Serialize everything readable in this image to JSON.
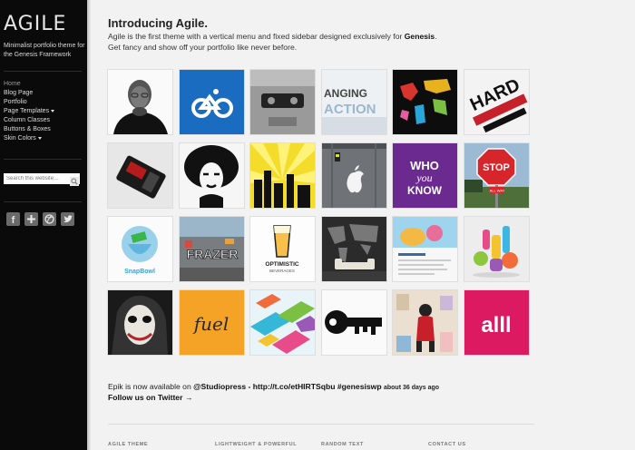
{
  "sidebar": {
    "logo": "AGILE",
    "tagline": "Minimalist portfolio theme for the Genesis Framework",
    "menu": [
      "Home",
      "Blog Page",
      "Portfolio",
      "Page Templates",
      "Column Classes",
      "Buttons & Boxes",
      "Skin Colors"
    ],
    "search_placeholder": "Search this website…",
    "social_icons": [
      "facebook-icon",
      "google-plus-icon",
      "dribbble-icon",
      "twitter-icon"
    ]
  },
  "intro": {
    "title": "Introducing Agile.",
    "line1_pre": "Agile is the first theme with a vertical menu and fixed sidebar designed exclusively for ",
    "line1_bold": "Genesis",
    "line1_post": ".",
    "line2": "Get fancy and show off your portfolio like never before."
  },
  "portfolio": {
    "thumbs": [
      "thumb-portrait-man",
      "thumb-bike-logo",
      "thumb-cassette",
      "thumb-changing-action",
      "thumb-word-map",
      "thumb-hard-typography",
      "thumb-gadget",
      "thumb-afro-portrait",
      "thumb-city-rays",
      "thumb-apple-store",
      "thumb-who-you-know",
      "thumb-stop-sign",
      "thumb-snapbowl",
      "thumb-graffiti",
      "thumb-optimistic-beverages",
      "thumb-dot-world-map",
      "thumb-website-shot",
      "thumb-colorful-figures",
      "thumb-joker",
      "thumb-fuel",
      "thumb-isometric",
      "thumb-key",
      "thumb-collage",
      "thumb-alll"
    ],
    "texts": {
      "action_top": "ANGING",
      "action_bottom": "ACTION",
      "hard": "HARD",
      "who1": "WHO",
      "who2": "you",
      "who3": "KNOW",
      "stop": "STOP",
      "stop_sub": "ALL WAY",
      "snapbowl": "SnapBowl",
      "optimistic1": "OPTIMISTIC",
      "optimistic2": "BEVERAGES",
      "fuel": "fuel",
      "alll": "alll",
      "graffiti": "FRAZER"
    }
  },
  "twitter": {
    "pre": "Epik is now available on ",
    "bold": "@Studiopress - http://t.co/etHIRTSqbu #genesiswp",
    "ago": "about 36 days ago",
    "follow": "Follow us on Twitter →"
  },
  "footer": {
    "headings": [
      "AGILE THEME",
      "LIGHTWEIGHT & POWERFUL",
      "RANDOM TEXT",
      "CONTACT US"
    ]
  },
  "colors": {
    "sidebar_bg": "#0a0a0a",
    "page_bg": "#f2f2f2"
  }
}
